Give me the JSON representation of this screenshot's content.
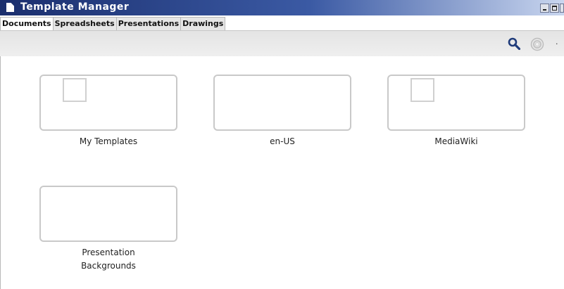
{
  "window": {
    "title": "Template Manager",
    "title_gradient": [
      "#1b2f6e",
      "#3b5aa4",
      "#c9d6ef"
    ]
  },
  "tabs": [
    {
      "label": "Documents",
      "active": true
    },
    {
      "label": "Spreadsheets",
      "active": false
    },
    {
      "label": "Presentations",
      "active": false
    },
    {
      "label": "Drawings",
      "active": false
    }
  ],
  "toolbar": {
    "icons": [
      "search-icon",
      "settings-icon",
      "dropdown-icon"
    ],
    "dropdown_glyph": "·"
  },
  "folders": [
    {
      "label": "My Templates",
      "has_document": true
    },
    {
      "label": "en-US",
      "has_document": false
    },
    {
      "label": "MediaWiki",
      "has_document": true
    },
    {
      "label_lines": [
        "Presentation",
        "Backgrounds"
      ],
      "has_document": false
    }
  ],
  "colors": {
    "accent": "#1f3b7a",
    "border": "#c9c9c9"
  }
}
